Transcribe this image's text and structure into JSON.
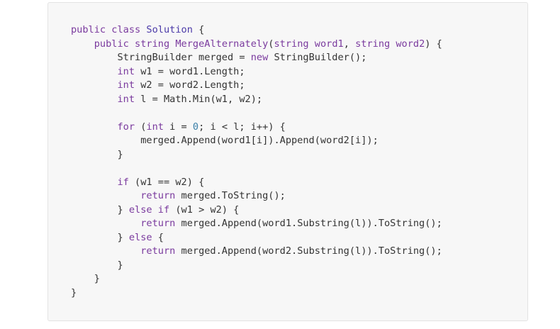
{
  "colors": {
    "panel_background": "#f7f7f7",
    "panel_border": "#e3e3e3",
    "default_text": "#333333",
    "keyword": "#7a3a9e",
    "class_name": "#4b3aa8",
    "number": "#3a7fa8"
  },
  "code": {
    "language": "csharp",
    "lines": [
      [
        {
          "t": "kw",
          "v": "public"
        },
        {
          "t": "id",
          "v": " "
        },
        {
          "t": "kw",
          "v": "class"
        },
        {
          "t": "id",
          "v": " "
        },
        {
          "t": "class",
          "v": "Solution"
        },
        {
          "t": "id",
          "v": " {"
        }
      ],
      [
        {
          "t": "id",
          "v": "    "
        },
        {
          "t": "kw",
          "v": "public"
        },
        {
          "t": "id",
          "v": " "
        },
        {
          "t": "type",
          "v": "string"
        },
        {
          "t": "id",
          "v": " "
        },
        {
          "t": "fn",
          "v": "MergeAlternately"
        },
        {
          "t": "id",
          "v": "("
        },
        {
          "t": "type",
          "v": "string"
        },
        {
          "t": "id",
          "v": " "
        },
        {
          "t": "type",
          "v": "word1"
        },
        {
          "t": "id",
          "v": ", "
        },
        {
          "t": "type",
          "v": "string"
        },
        {
          "t": "id",
          "v": " "
        },
        {
          "t": "type",
          "v": "word2"
        },
        {
          "t": "id",
          "v": ") {"
        }
      ],
      [
        {
          "t": "id",
          "v": "        StringBuilder merged = "
        },
        {
          "t": "kw",
          "v": "new"
        },
        {
          "t": "id",
          "v": " StringBuilder();"
        }
      ],
      [
        {
          "t": "id",
          "v": "        "
        },
        {
          "t": "type",
          "v": "int"
        },
        {
          "t": "id",
          "v": " w1 = word1.Length;"
        }
      ],
      [
        {
          "t": "id",
          "v": "        "
        },
        {
          "t": "type",
          "v": "int"
        },
        {
          "t": "id",
          "v": " w2 = word2.Length;"
        }
      ],
      [
        {
          "t": "id",
          "v": "        "
        },
        {
          "t": "type",
          "v": "int"
        },
        {
          "t": "id",
          "v": " l = Math.Min(w1, w2);"
        }
      ],
      [
        {
          "t": "id",
          "v": ""
        }
      ],
      [
        {
          "t": "id",
          "v": "        "
        },
        {
          "t": "kw",
          "v": "for"
        },
        {
          "t": "id",
          "v": " ("
        },
        {
          "t": "type",
          "v": "int"
        },
        {
          "t": "id",
          "v": " i = "
        },
        {
          "t": "num",
          "v": "0"
        },
        {
          "t": "id",
          "v": "; i < l; i++) {"
        }
      ],
      [
        {
          "t": "id",
          "v": "            merged.Append(word1[i]).Append(word2[i]);"
        }
      ],
      [
        {
          "t": "id",
          "v": "        }"
        }
      ],
      [
        {
          "t": "id",
          "v": ""
        }
      ],
      [
        {
          "t": "id",
          "v": "        "
        },
        {
          "t": "kw",
          "v": "if"
        },
        {
          "t": "id",
          "v": " (w1 == w2) {"
        }
      ],
      [
        {
          "t": "id",
          "v": "            "
        },
        {
          "t": "kw",
          "v": "return"
        },
        {
          "t": "id",
          "v": " merged.ToString();"
        }
      ],
      [
        {
          "t": "id",
          "v": "        } "
        },
        {
          "t": "kw",
          "v": "else"
        },
        {
          "t": "id",
          "v": " "
        },
        {
          "t": "kw",
          "v": "if"
        },
        {
          "t": "id",
          "v": " (w1 > w2) {"
        }
      ],
      [
        {
          "t": "id",
          "v": "            "
        },
        {
          "t": "kw",
          "v": "return"
        },
        {
          "t": "id",
          "v": " merged.Append(word1.Substring(l)).ToString();"
        }
      ],
      [
        {
          "t": "id",
          "v": "        } "
        },
        {
          "t": "kw",
          "v": "else"
        },
        {
          "t": "id",
          "v": " {"
        }
      ],
      [
        {
          "t": "id",
          "v": "            "
        },
        {
          "t": "kw",
          "v": "return"
        },
        {
          "t": "id",
          "v": " merged.Append(word2.Substring(l)).ToString();"
        }
      ],
      [
        {
          "t": "id",
          "v": "        }"
        }
      ],
      [
        {
          "t": "id",
          "v": "    }"
        }
      ],
      [
        {
          "t": "id",
          "v": "}"
        }
      ]
    ]
  }
}
